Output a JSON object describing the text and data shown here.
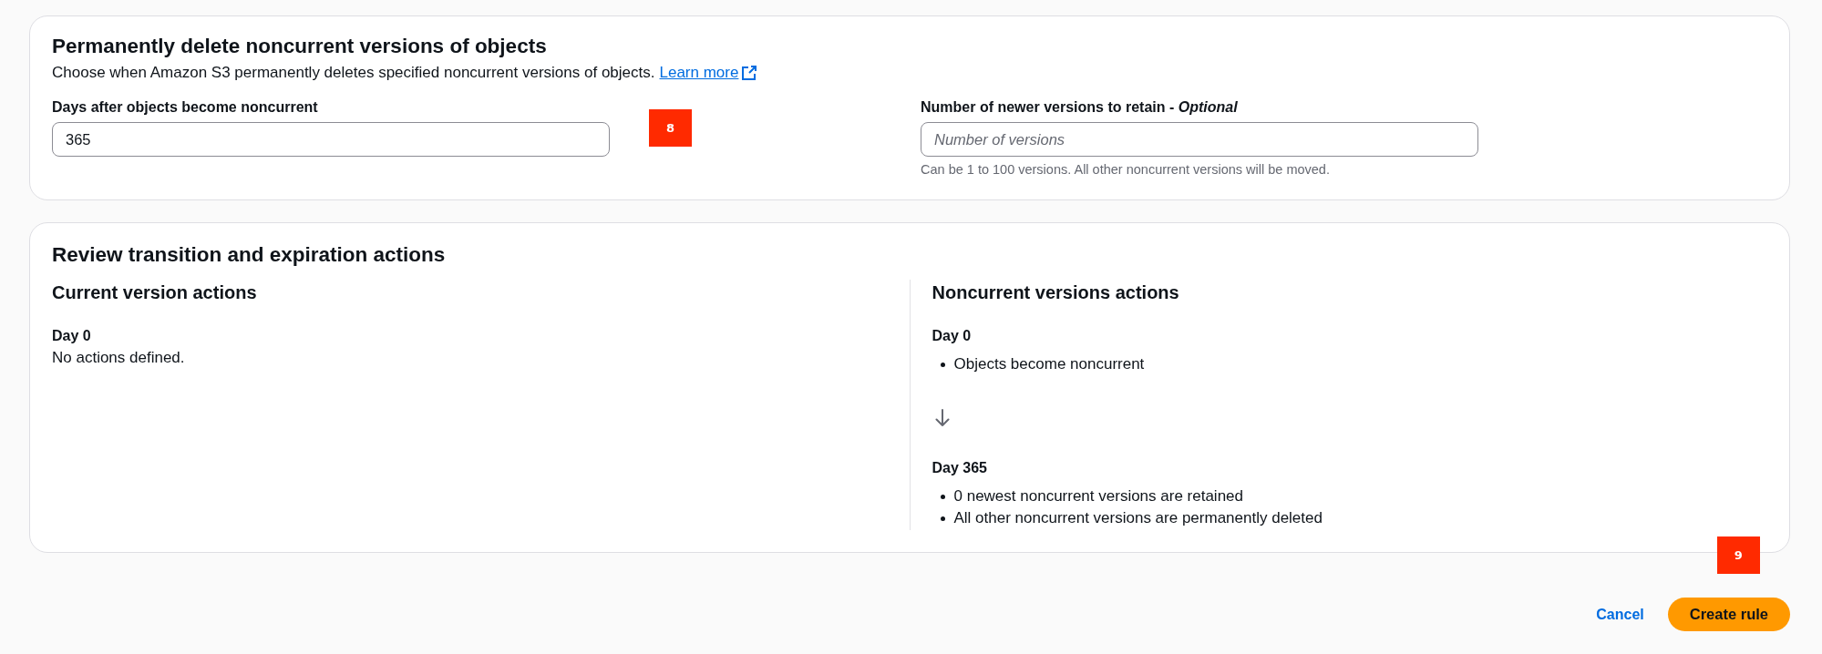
{
  "lifecycle_panel": {
    "title": "Permanently delete noncurrent versions of objects",
    "description": "Choose when Amazon S3 permanently deletes specified noncurrent versions of objects.",
    "link": "Learn more",
    "marker": "8",
    "fields": [
      {
        "label": "Days after objects become noncurrent",
        "value": "365"
      },
      {
        "label": "Number of newer versions to retain - *Optional*",
        "placeholder": "Number of versions",
        "hint": "Can be 1 to 100 versions. All other noncurrent versions will be moved."
      }
    ]
  },
  "review_panel": {
    "title": "Review transition and expiration actions",
    "columns": [
      {
        "title": "Current version actions",
        "steps": [
          {
            "day": "Day 0",
            "kind": "text",
            "text": "No actions defined."
          }
        ]
      },
      {
        "title": "Noncurrent versions actions",
        "steps": [
          {
            "day": "Day 0",
            "kind": "list",
            "items": [
              "Objects become noncurrent"
            ]
          },
          {
            "day": "Day 365",
            "kind": "list",
            "items": [
              "0 newest noncurrent versions are retained",
              "All other noncurrent versions are permanently deleted"
            ]
          }
        ]
      }
    ]
  },
  "footer": {
    "cancel": "Cancel",
    "submit": "Create rule",
    "marker": "9"
  }
}
